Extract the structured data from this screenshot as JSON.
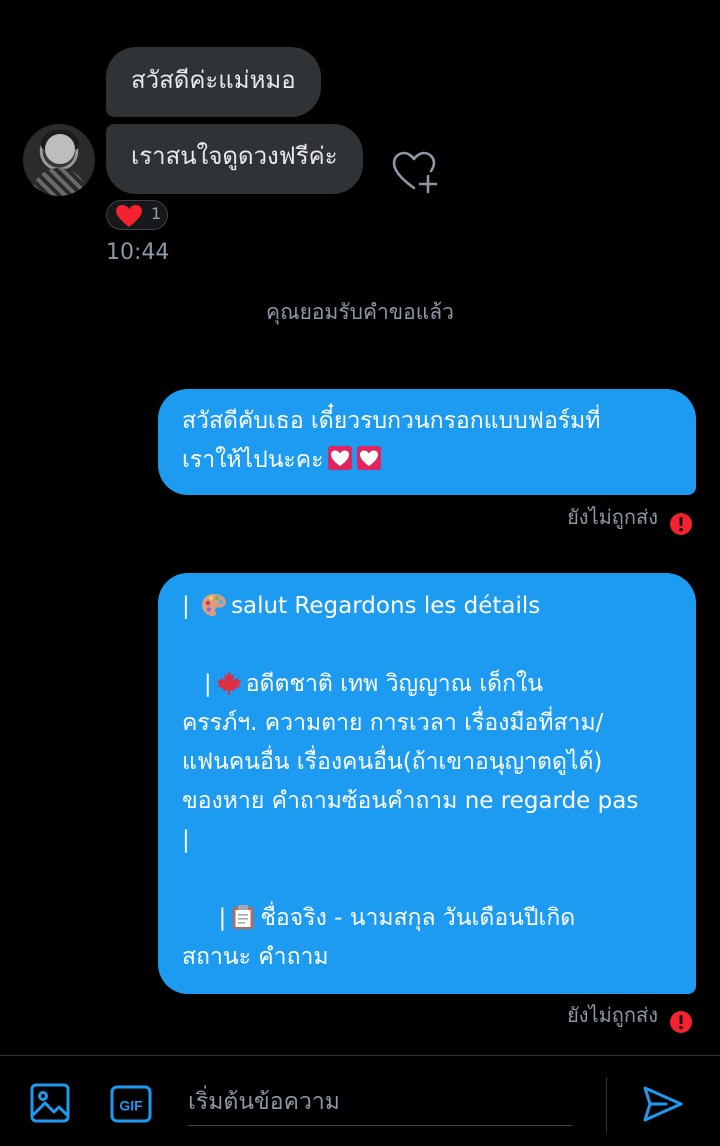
{
  "conversation": {
    "incoming": [
      {
        "text": "สวัสดีค่ะแม่หมอ"
      },
      {
        "text": "เราสนใจดูดวงฟรีค่ะ"
      }
    ],
    "reaction": {
      "icon": "heart-icon",
      "count": "1"
    },
    "timestamp": "10:44",
    "system_note": "คุณยอมรับคำขอแล้ว",
    "outgoing": [
      {
        "lines": [
          "สวัสดีคับเธอ เดี๋ยวรบกวนกรอกแบบฟอร์มที่",
          "เราให้ไปนะคะ"
        ],
        "status": "ยังไม่ถูกส่ง"
      },
      {
        "lines": [
          "| ",
          "salut Regardons les détails",
          "",
          "   |",
          "อดีตชาติ เทพ วิญญาณ เด็กใน",
          "ครรภ์ฯ. ความตาย การเวลา เรื่องมือที่สาม/",
          "แฟนคนอื่น เรื่องคนอื่น(ถ้าเขาอนุญาตดูได้)",
          "ของหาย คำถามซ้อนคำถาม ne regarde pas",
          "|",
          "",
          "     |",
          "ชื่อจริง - นามสกุล วันเดือนปีเกิด",
          "สถานะ คำถาม"
        ],
        "status": "ยังไม่ถูกส่ง"
      }
    ]
  },
  "composer": {
    "placeholder": "เริ่มต้นข้อความ",
    "icons": [
      "image-icon",
      "gif-icon",
      "send-icon"
    ]
  },
  "colors": {
    "background": "#000000",
    "incoming_bubble": "#2f3336",
    "outgoing_bubble": "#1d9bf0",
    "accent": "#1d9bf0",
    "error": "#f4212e",
    "muted_text": "#8b98a5"
  }
}
